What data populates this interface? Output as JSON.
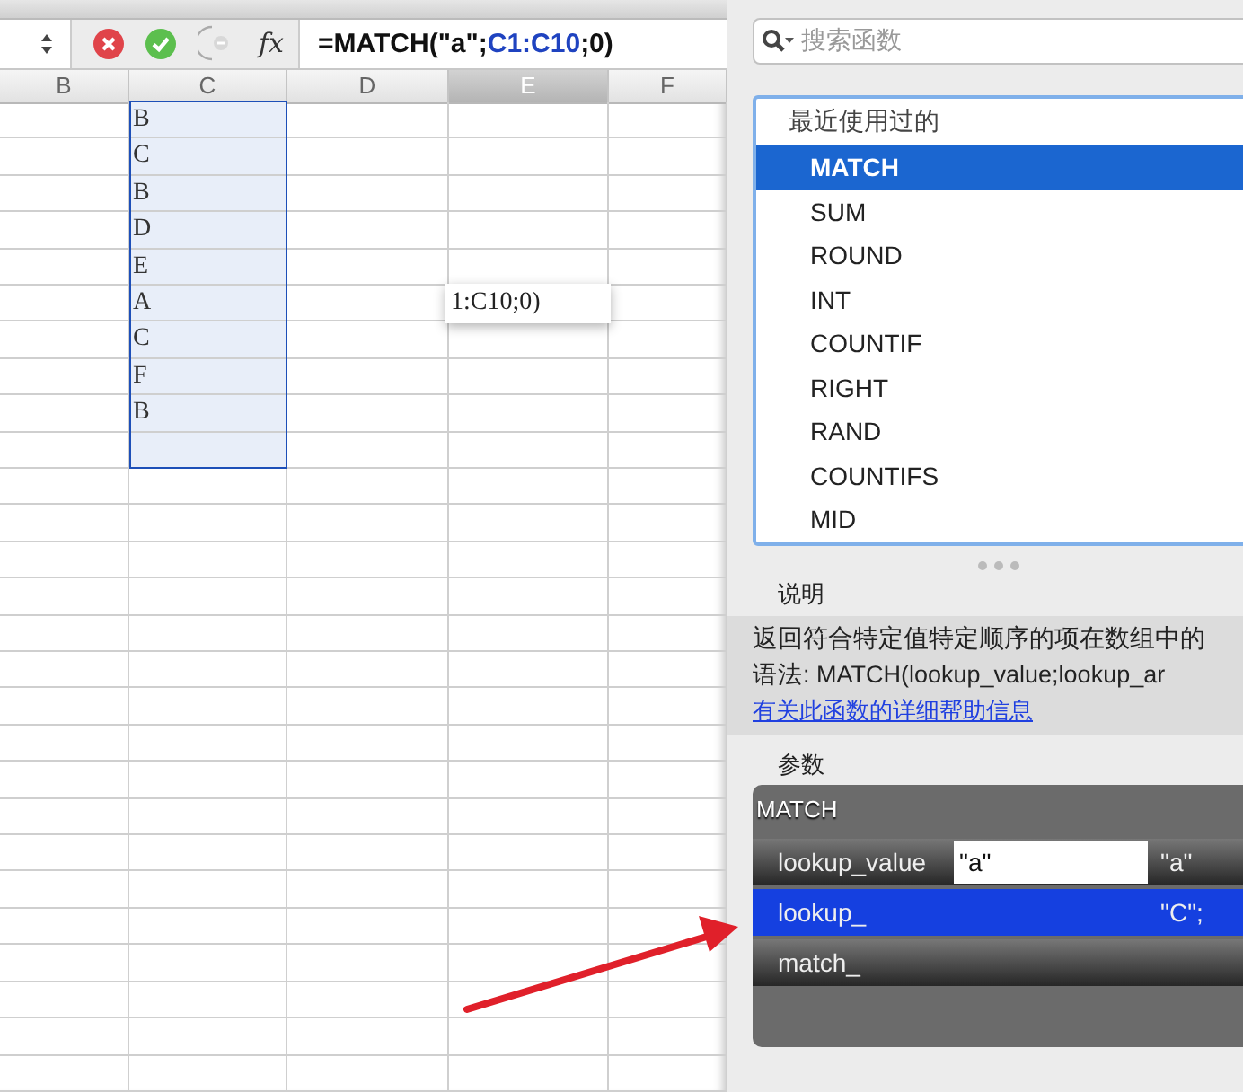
{
  "formula_bar": {
    "function_label": "fx",
    "formula": [
      {
        "text": "=MATCH(\"a\";",
        "kind": "plain"
      },
      {
        "text": "C1:C10",
        "kind": "reference"
      },
      {
        "text": ";0)",
        "kind": "plain"
      }
    ]
  },
  "columns": [
    {
      "label": "B",
      "selected": false
    },
    {
      "label": "C",
      "selected": false
    },
    {
      "label": "D",
      "selected": false
    },
    {
      "label": "E",
      "selected": true
    },
    {
      "label": "F",
      "selected": false
    }
  ],
  "column_c_cells": [
    {
      "text": "B",
      "selected": true
    },
    {
      "text": "C",
      "selected": true
    },
    {
      "text": "B",
      "selected": true
    },
    {
      "text": "D",
      "selected": true
    },
    {
      "text": "E",
      "selected": true
    },
    {
      "text": "A",
      "selected": true
    },
    {
      "text": "C",
      "selected": true
    },
    {
      "text": "F",
      "selected": true
    },
    {
      "text": "B",
      "selected": true
    },
    {
      "selected": true
    }
  ],
  "cell_editor": {
    "text": "1:C10;0)"
  },
  "function_panel": {
    "search": {
      "placeholder": "搜索函数"
    },
    "list_heading": "最近使用过的",
    "functions": [
      {
        "name": "MATCH",
        "selected": true
      },
      {
        "name": "SUM",
        "selected": false
      },
      {
        "name": "ROUND",
        "selected": false
      },
      {
        "name": "INT",
        "selected": false
      },
      {
        "name": "COUNTIF",
        "selected": false
      },
      {
        "name": "RIGHT",
        "selected": false
      },
      {
        "name": "RAND",
        "selected": false
      },
      {
        "name": "COUNTIFS",
        "selected": false
      },
      {
        "name": "MID",
        "selected": false
      }
    ],
    "description_heading": "说明",
    "description": [
      "返回符合特定值特定顺序的项在数组中的",
      "语法:  MATCH(lookup_value;lookup_ar"
    ],
    "help_link": "有关此函数的详细帮助信息",
    "arguments_heading": "参数",
    "arguments_title": "MATCH",
    "arguments": [
      {
        "name": "lookup_value",
        "value": "\"a\"",
        "result": "\"a\"",
        "selected": false
      },
      {
        "name": "lookup_",
        "result": "\"C\";",
        "selected": true
      },
      {
        "name": "match_",
        "selected": false
      }
    ]
  }
}
